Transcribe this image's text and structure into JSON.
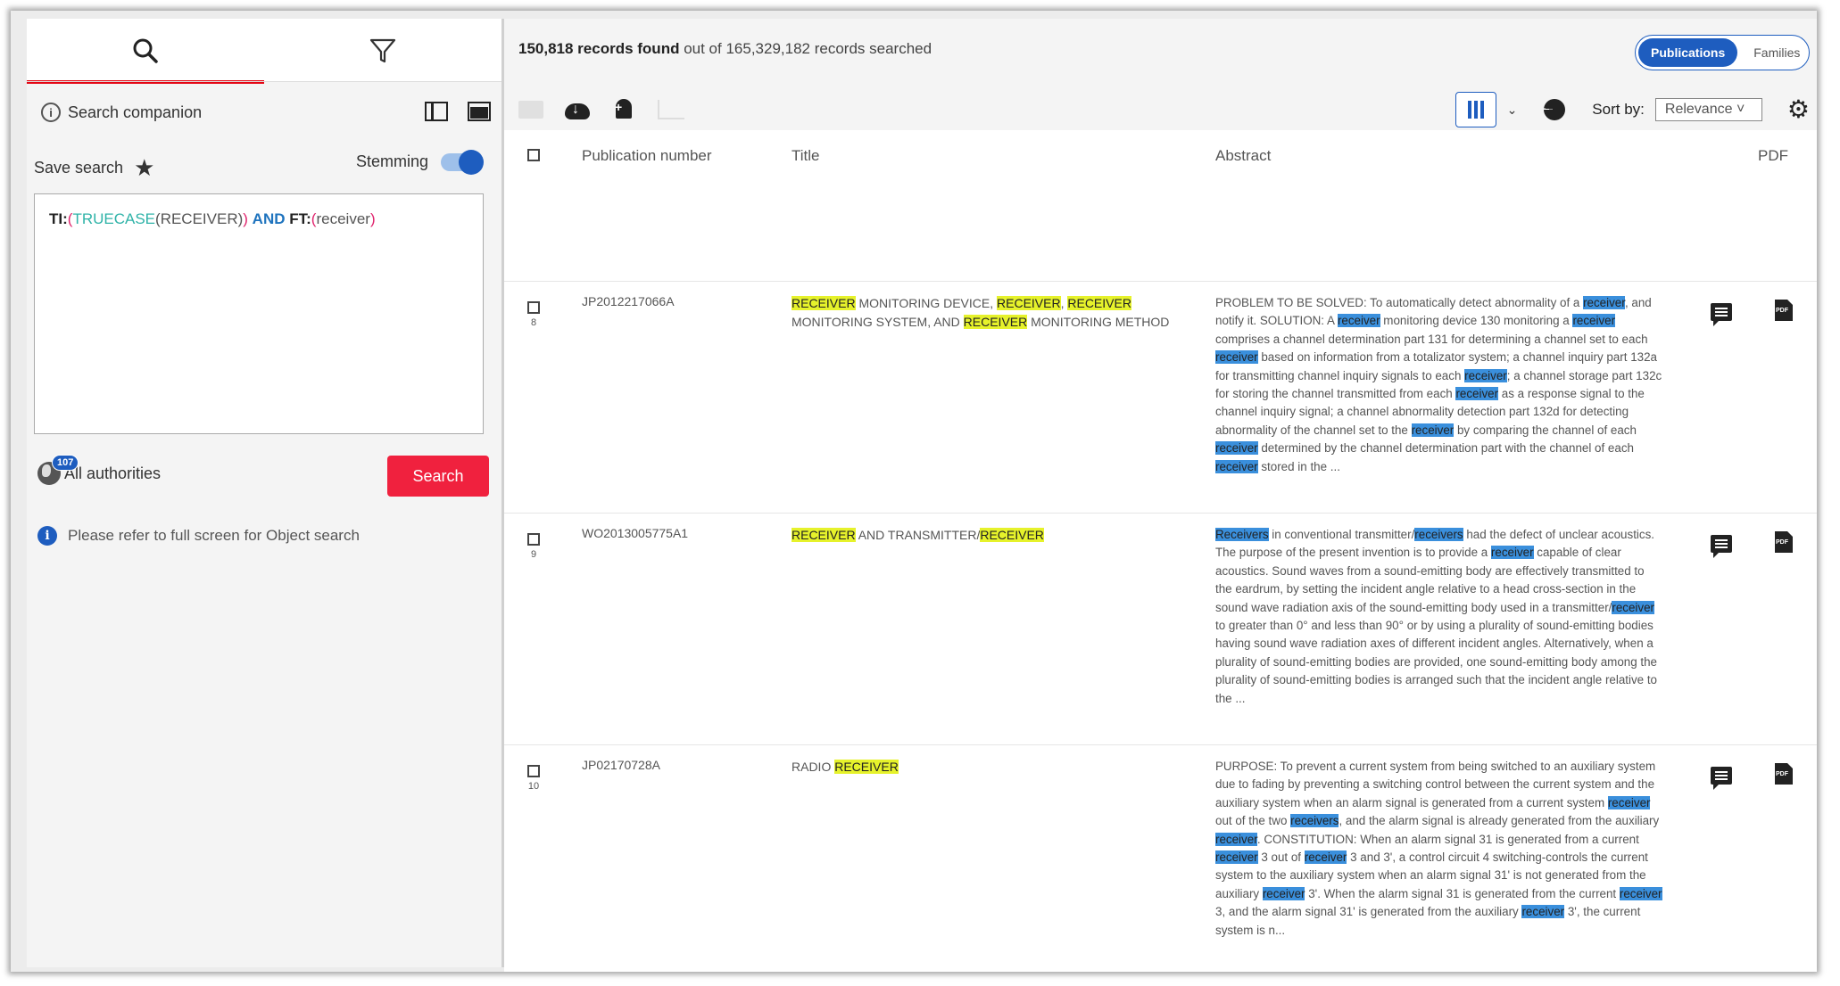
{
  "left_panel": {
    "tabs": [
      {
        "name": "search-icon",
        "active": true
      },
      {
        "name": "filter-icon",
        "active": false
      }
    ],
    "companion_label": "Search companion",
    "save_search_label": "Save search",
    "stemming_label": "Stemming",
    "stemming_enabled": true,
    "query": {
      "field1": "TI:",
      "paren_open": "(",
      "function": "TRUECASE",
      "inner": "(RECEIVER)",
      "paren_close": ")",
      "operator": "AND",
      "field2": "FT:",
      "paren2_open": "(",
      "term2": "receiver",
      "paren2_close": ")"
    },
    "authorities_count": "107",
    "authorities_label": "All authorities",
    "search_button": "Search",
    "notice": "Please refer to full screen for Object search"
  },
  "results_header": {
    "count": "150,818 records found",
    "searched": "out of 165,329,182 records searched",
    "segment": {
      "active": "Publications",
      "inactive": "Families"
    },
    "sort_label": "Sort by:",
    "sort_value": "Relevance ˅"
  },
  "columns": {
    "pubnum": "Publication number",
    "title": "Title",
    "abstract": "Abstract",
    "pdf": "PDF"
  },
  "colors": {
    "accent": "#1e5dbf",
    "search_button": "#f0213e",
    "active_tab": "#e30613",
    "highlight_title": "#e6f22b",
    "highlight_abstract": "#3a8fdc"
  },
  "rows": [
    {
      "index": "8",
      "pubnum": "JP2012217066A",
      "title": [
        [
          "RECEIVER",
          "y"
        ],
        [
          " MONITORING DEVICE, ",
          ""
        ],
        [
          "RECEIVER",
          "y"
        ],
        [
          ", ",
          ""
        ],
        [
          "RECEIVER",
          "y"
        ],
        [
          " MONITORING SYSTEM, AND ",
          ""
        ],
        [
          "RECEIVER",
          "y"
        ],
        [
          " MONITORING METHOD",
          ""
        ]
      ],
      "abstract": [
        [
          "PROBLEM TO BE SOLVED: To automatically detect abnormality of a ",
          ""
        ],
        [
          "receiver",
          "b"
        ],
        [
          ", and notify it. SOLUTION: A ",
          ""
        ],
        [
          "receiver",
          "b"
        ],
        [
          " monitoring device 130 monitoring a ",
          ""
        ],
        [
          "receiver",
          "b"
        ],
        [
          " comprises a channel determination part 131 for determining a channel set to each ",
          ""
        ],
        [
          "receiver",
          "b"
        ],
        [
          " based on information from a totalizator system; a channel inquiry part 132a for transmitting channel inquiry signals to each ",
          ""
        ],
        [
          "receiver",
          "b"
        ],
        [
          "; a channel storage part 132c for storing the channel transmitted from each ",
          ""
        ],
        [
          "receiver",
          "b"
        ],
        [
          " as a response signal to the channel inquiry signal; a channel abnormality detection part 132d for detecting abnormality of the channel set to the ",
          ""
        ],
        [
          "receiver",
          "b"
        ],
        [
          " by comparing the channel of each ",
          ""
        ],
        [
          "receiver",
          "b"
        ],
        [
          " determined by the channel determination part with the channel of each ",
          ""
        ],
        [
          "receiver",
          "b"
        ],
        [
          " stored in the ...",
          ""
        ]
      ]
    },
    {
      "index": "9",
      "pubnum": "WO2013005775A1",
      "title": [
        [
          "RECEIVER",
          "y"
        ],
        [
          " AND TRANSMITTER/",
          ""
        ],
        [
          "RECEIVER",
          "y"
        ]
      ],
      "abstract": [
        [
          "Receivers",
          "b"
        ],
        [
          " in conventional transmitter/",
          ""
        ],
        [
          "receivers",
          "b"
        ],
        [
          " had the defect of unclear acoustics. The purpose of the present invention is to provide a ",
          ""
        ],
        [
          "receiver",
          "b"
        ],
        [
          " capable of clear acoustics. Sound waves from a sound-emitting body are effectively transmitted to the eardrum, by setting the incident angle relative to a head cross-section in the sound wave radiation axis of the sound-emitting body used in a transmitter/",
          ""
        ],
        [
          "receiver",
          "b"
        ],
        [
          " to greater than 0° and less than 90° or by using a plurality of sound-emitting bodies having sound wave radiation axes of different incident angles. Alternatively, when a plurality of sound-emitting bodies are provided, one sound-emitting body among the plurality of sound-emitting bodies is arranged such that the incident angle relative to the ...",
          ""
        ]
      ]
    },
    {
      "index": "10",
      "pubnum": "JP02170728A",
      "title": [
        [
          "RADIO ",
          ""
        ],
        [
          "RECEIVER",
          "y"
        ]
      ],
      "abstract": [
        [
          "PURPOSE: To prevent a current system from being switched to an auxiliary system due to fading by preventing a switching control between the current system and the auxiliary system when an alarm signal is generated from a current system ",
          ""
        ],
        [
          "receiver",
          "b"
        ],
        [
          " out of the two ",
          ""
        ],
        [
          "receivers",
          "b"
        ],
        [
          ", and the alarm signal is already generated from the auxiliary ",
          ""
        ],
        [
          "receiver",
          "b"
        ],
        [
          ". CONSTITUTION: When an alarm signal 31 is generated from a current ",
          ""
        ],
        [
          "receiver",
          "b"
        ],
        [
          " 3 out of ",
          ""
        ],
        [
          "receiver",
          "b"
        ],
        [
          " 3 and 3', a control circuit 4 switching-controls the current system to the auxiliary system when an alarm signal 31' is not generated from the auxiliary ",
          ""
        ],
        [
          "receiver",
          "b"
        ],
        [
          " 3'. When the alarm signal 31 is generated from the current ",
          ""
        ],
        [
          "receiver",
          "b"
        ],
        [
          " 3, and the alarm signal 31' is generated from the auxiliary ",
          ""
        ],
        [
          "receiver",
          "b"
        ],
        [
          " 3', the current system is n...",
          ""
        ]
      ]
    }
  ]
}
